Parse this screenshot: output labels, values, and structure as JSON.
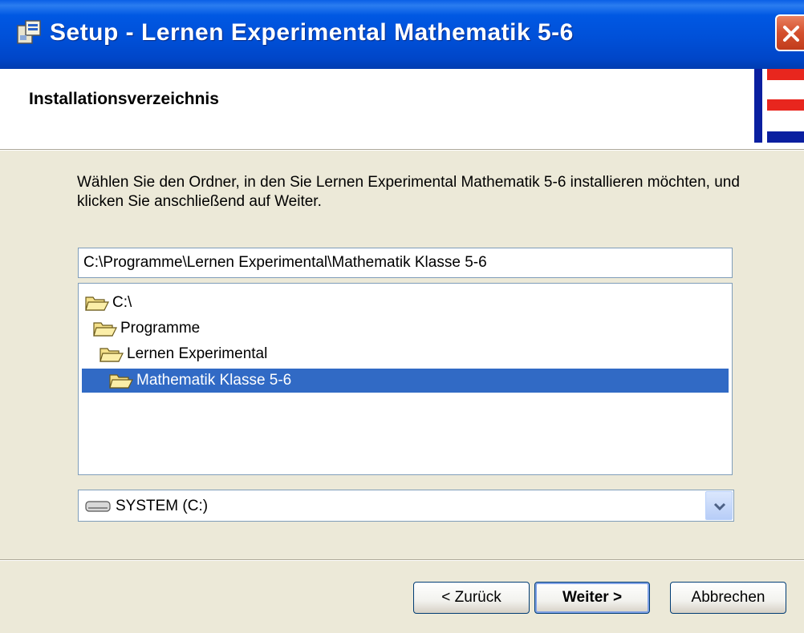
{
  "window": {
    "title": "Setup - Lernen Experimental Mathematik 5-6",
    "close_icon": "close-icon"
  },
  "header": {
    "title": "Installationsverzeichnis",
    "logo": "lernen-experimental-logo"
  },
  "content": {
    "description": "Wählen Sie den Ordner, in den Sie Lernen Experimental Mathematik 5-6 installieren möchten, und klicken Sie anschließend auf Weiter.",
    "path_value": "C:\\Programme\\Lernen Experimental\\Mathematik Klasse 5-6",
    "folder_tree": [
      {
        "label": "C:\\",
        "icon": "folder-open-icon",
        "selected": false
      },
      {
        "label": "Programme",
        "icon": "folder-open-icon",
        "selected": false
      },
      {
        "label": "Lernen Experimental",
        "icon": "folder-open-icon",
        "selected": false
      },
      {
        "label": "Mathematik Klasse 5-6",
        "icon": "folder-open-icon",
        "selected": true
      }
    ],
    "drive": {
      "label": "SYSTEM (C:)",
      "icon": "drive-icon"
    }
  },
  "buttons": {
    "back": "< Zurück",
    "next": "Weiter >",
    "cancel": "Abbrechen"
  },
  "colors": {
    "titlebar": "#0054e3",
    "selection": "#316ac5",
    "logo_blue": "#0a1fa0",
    "logo_red": "#e8261e"
  }
}
